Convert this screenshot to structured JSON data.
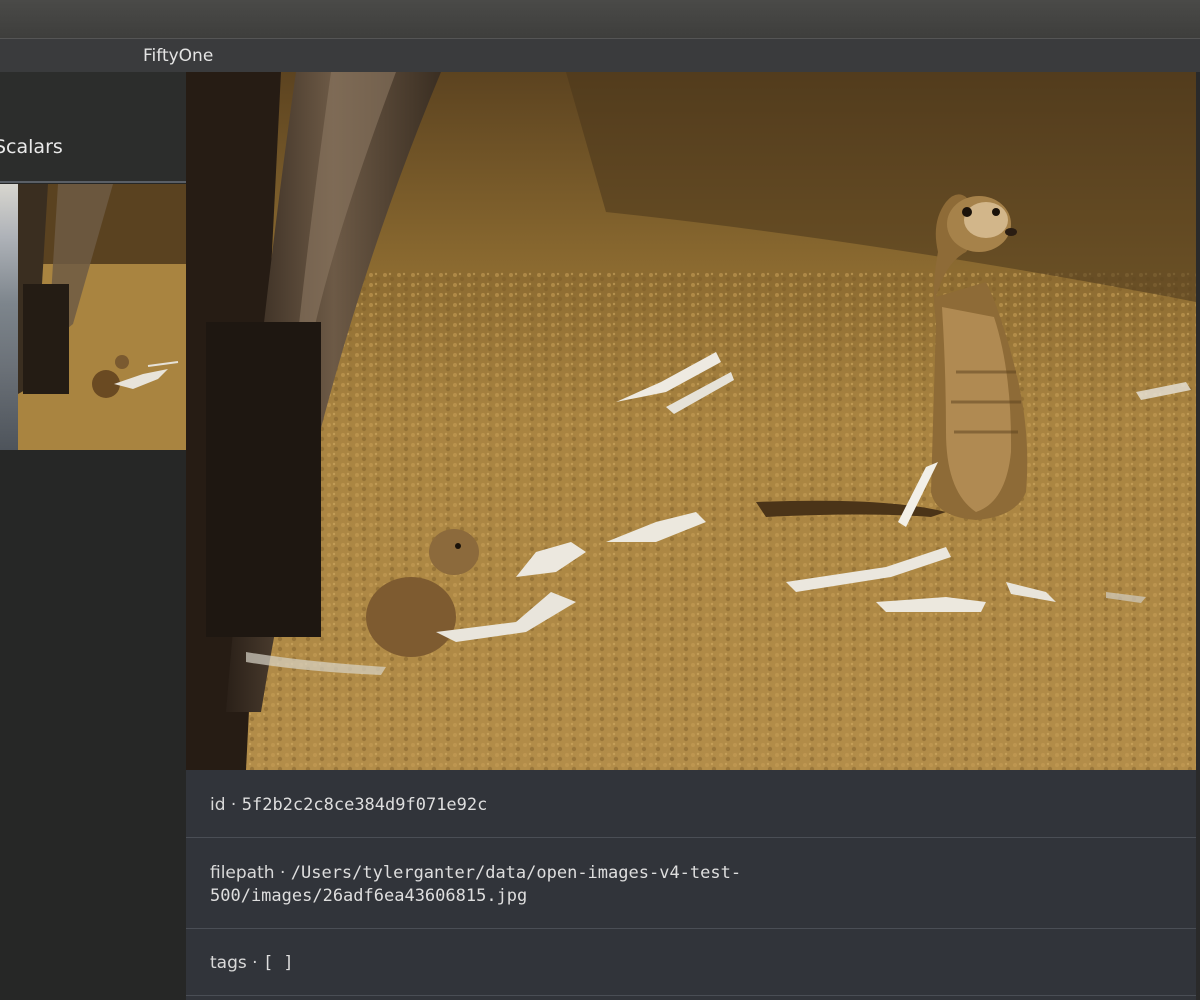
{
  "window": {
    "title": "FiftyOne"
  },
  "sidebar": {
    "section_label": "Scalars"
  },
  "sample": {
    "id": {
      "key": "id · ",
      "value": "5f2b2c2c8ce384d9f071e92c"
    },
    "filepath": {
      "key": "filepath · ",
      "value_line1": "/Users/tylerganter/data/open-images-v4-test-",
      "value_line2": "500/images/26adf6ea43606815.jpg"
    },
    "tags": {
      "key": "tags · ",
      "value": "[ ]"
    }
  },
  "colors": {
    "panel_bg": "#31343a",
    "sidebar_bg": "#262726",
    "titlebar_bg": "#3a3b3d"
  }
}
